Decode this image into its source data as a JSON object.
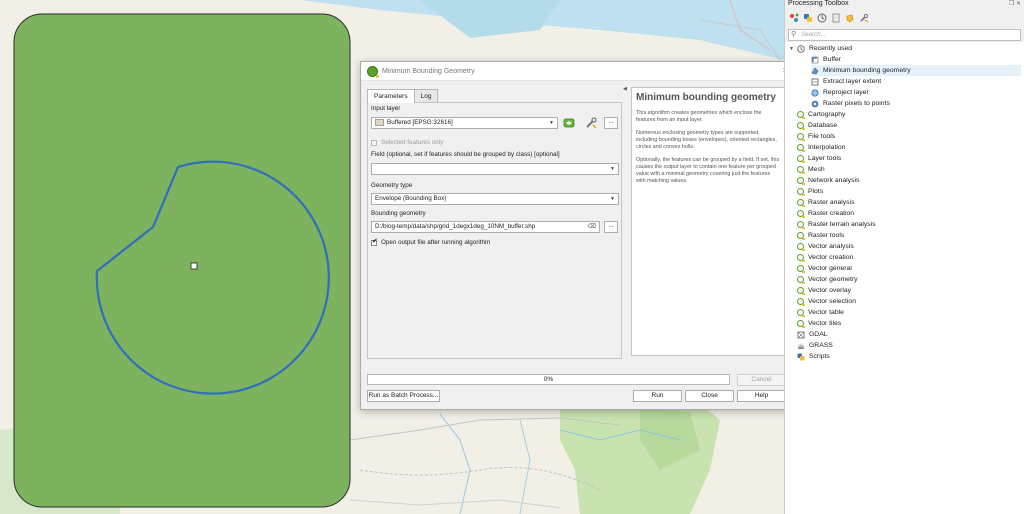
{
  "dialog": {
    "title": "Minimum Bounding Geometry",
    "close_glyph": "×",
    "tabs": [
      {
        "label": "Parameters",
        "active": true
      },
      {
        "label": "Log",
        "active": false
      }
    ],
    "input_layer": {
      "label": "Input layer",
      "value": "Buffered [EPSG:32616]",
      "browse_label": "..."
    },
    "selected_features_only": {
      "label": "Selected features only",
      "checked": false
    },
    "field": {
      "label": "Field (optional, set if features should be grouped by class) [optional]",
      "value": ""
    },
    "geometry_type": {
      "label": "Geometry type",
      "value": "Envelope (Bounding Box)"
    },
    "bounding_geometry": {
      "label": "Bounding geometry",
      "value": "D:/blog-temp/data/shp/grid_1degx1deg_10NM_buffer.shp",
      "clear_glyph": "⌫",
      "browse_label": "..."
    },
    "open_output": {
      "label": "Open output file after running algorithm",
      "checked": true
    },
    "help": {
      "title": "Minimum bounding geometry",
      "paragraphs": [
        "This algorithm creates geometries which enclose the features from an input layer.",
        "Numerous enclosing geometry types are supported, including bounding boxes (envelopes), oriented rectangles, circles and convex hulls.",
        "Optionally, the features can be grouped by a field. If set, this causes the output layer to contain one feature per grouped value with a minimal geometry covering just the features with matching values."
      ]
    },
    "progress": {
      "text": "0%",
      "value": 0
    },
    "buttons": {
      "cancel": "Cancel",
      "batch": "Run as Batch Process...",
      "run": "Run",
      "close": "Close",
      "help": "Help"
    }
  },
  "toolbox": {
    "title": "Processing Toolbox",
    "search_placeholder": "Search...",
    "recently_used": {
      "label": "Recently used",
      "items": [
        {
          "label": "Buffer",
          "selected": false
        },
        {
          "label": "Minimum bounding geometry",
          "selected": true
        },
        {
          "label": "Extract layer extent",
          "selected": false
        },
        {
          "label": "Reproject layer",
          "selected": false
        },
        {
          "label": "Raster pixels to points",
          "selected": false
        }
      ]
    },
    "groups": [
      "Cartography",
      "Database",
      "File tools",
      "Interpolation",
      "Layer tools",
      "Mesh",
      "Network analysis",
      "Plots",
      "Raster analysis",
      "Raster creation",
      "Raster terrain analysis",
      "Raster tools",
      "Vector analysis",
      "Vector creation",
      "Vector general",
      "Vector geometry",
      "Vector overlay",
      "Vector selection",
      "Vector table",
      "Vector tiles"
    ],
    "providers": [
      {
        "label": "GDAL",
        "icon": "gdal-icon"
      },
      {
        "label": "GRASS",
        "icon": "grass-icon"
      },
      {
        "label": "Scripts",
        "icon": "python-icon"
      }
    ]
  },
  "colors": {
    "polygon_fill": "#7db35f",
    "buffer_stroke": "#2f6fbd",
    "accent_green": "#5aa02c"
  }
}
